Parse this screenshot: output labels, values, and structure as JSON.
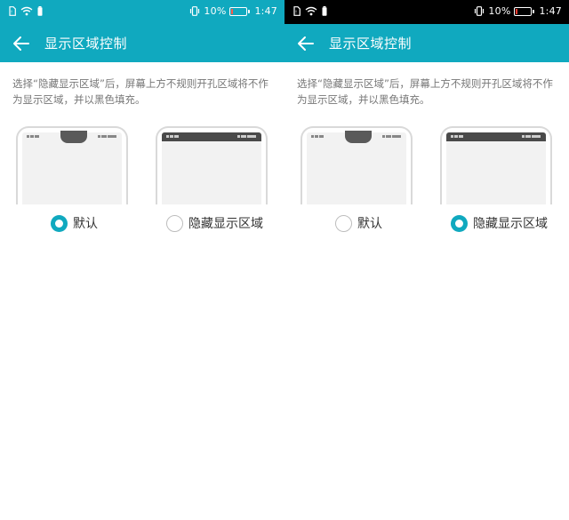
{
  "screens": [
    {
      "status": {
        "battery": "10%",
        "time": "1:47",
        "battery_fill": 0.1
      },
      "title": "显示区域控制",
      "description": "选择“隐藏显示区域”后，屏幕上方不规则开孔区域将不作为显示区域，并以黑色填充。",
      "options": [
        {
          "label": "默认",
          "selected": true
        },
        {
          "label": "隐藏显示区域",
          "selected": false
        }
      ]
    },
    {
      "status": {
        "battery": "10%",
        "time": "1:47",
        "battery_fill": 0.1
      },
      "title": "显示区域控制",
      "description": "选择“隐藏显示区域”后，屏幕上方不规则开孔区域将不作为显示区域，并以黑色填充。",
      "options": [
        {
          "label": "默认",
          "selected": false
        },
        {
          "label": "隐藏显示区域",
          "selected": true
        }
      ]
    }
  ],
  "colors": {
    "accent": "#10a9bf",
    "status_dark": "#000000"
  }
}
